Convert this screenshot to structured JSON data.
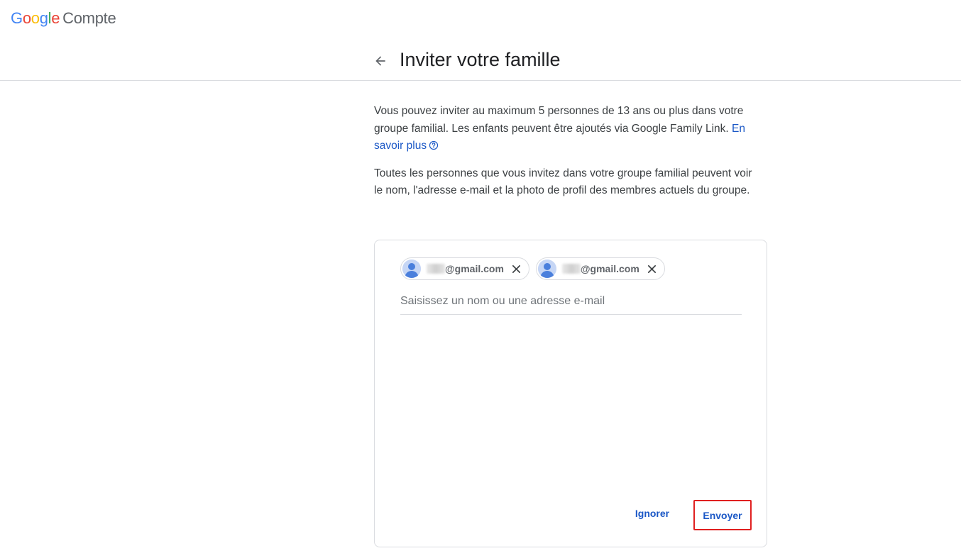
{
  "header": {
    "logo_letters": [
      "G",
      "o",
      "o",
      "g",
      "l",
      "e"
    ],
    "product_name": "Compte"
  },
  "page": {
    "title": "Inviter votre famille",
    "intro_text": "Vous pouvez inviter au maximum 5 personnes de 13 ans ou plus dans votre groupe familial. Les enfants peuvent être ajoutés via Google Family Link.",
    "learn_more_label": "En savoir plus",
    "visibility_text": "Toutes les personnes que vous invitez dans votre groupe familial peuvent voir le nom, l'adresse e-mail et la photo de profil des membres actuels du groupe."
  },
  "invite": {
    "chips": [
      {
        "email": "@gmail.com"
      },
      {
        "email": "@gmail.com"
      }
    ],
    "input_placeholder": "Saisissez un nom ou une adresse e-mail",
    "input_value": ""
  },
  "actions": {
    "ignore_label": "Ignorer",
    "send_label": "Envoyer"
  },
  "colors": {
    "link": "#1a57c6",
    "highlight_border": "#e02020",
    "google_blue": "#4285F4",
    "google_red": "#EA4335",
    "google_yellow": "#FBBC05",
    "google_green": "#34A853"
  },
  "icons": {
    "back": "arrow-left-icon",
    "help": "help-circle-icon",
    "avatar": "person-icon",
    "remove": "close-icon"
  }
}
